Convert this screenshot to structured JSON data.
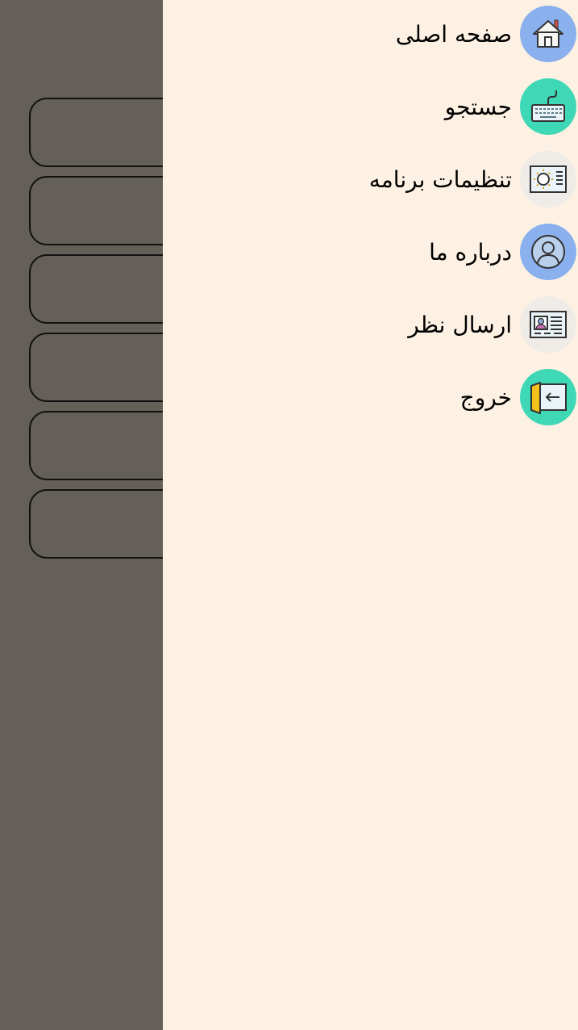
{
  "colors": {
    "drawer_background": "#FDF1E3",
    "backdrop": "#645F58",
    "blue": "#8AB0EE",
    "teal": "#3FD8B6",
    "grey": "#EFEBE6"
  },
  "menu": {
    "items": [
      {
        "label": "صفحه اصلی",
        "icon": "home-icon",
        "color": "#8AB0EE"
      },
      {
        "label": "جستجو",
        "icon": "keyboard-icon",
        "color": "#3FD8B6"
      },
      {
        "label": "تنظیمات برنامه",
        "icon": "settings-panel-icon",
        "color": "#EFEBE6"
      },
      {
        "label": "درباره ما",
        "icon": "user-icon",
        "color": "#8AB0EE"
      },
      {
        "label": "ارسال نظر",
        "icon": "id-card-icon",
        "color": "#EFEBE6"
      },
      {
        "label": "خروج",
        "icon": "exit-icon",
        "color": "#3FD8B6"
      }
    ]
  }
}
